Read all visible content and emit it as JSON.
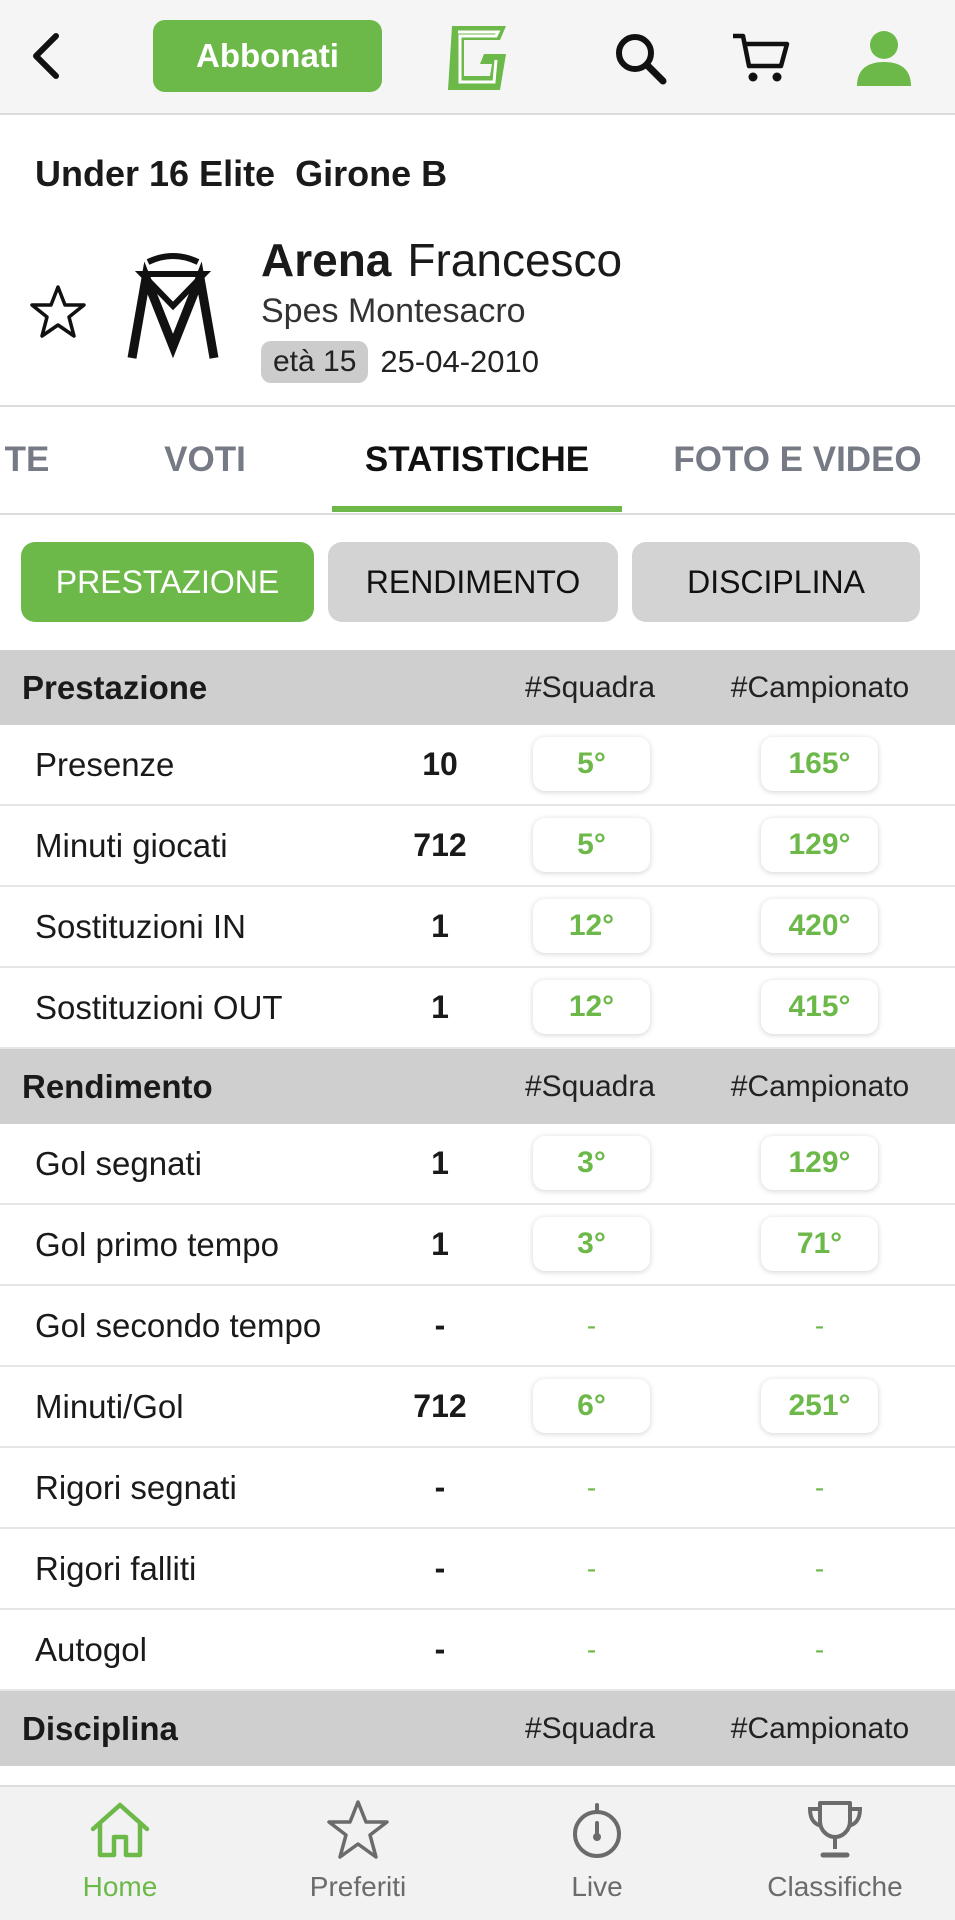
{
  "topbar": {
    "back_icon": "chevron-left-icon",
    "subscribe_label": "Abbonati",
    "logo_letter": "G",
    "search_icon": "search-icon",
    "cart_icon": "cart-icon",
    "user_icon": "user-icon"
  },
  "header": {
    "league": "Under 16 Elite  Girone B",
    "player_last": "Arena",
    "player_first": "Francesco",
    "team": "Spes Montesacro",
    "age_badge": "età 15",
    "dob": "25-04-2010"
  },
  "tabs": [
    {
      "label": "TE",
      "active": false
    },
    {
      "label": "VOTI",
      "active": false
    },
    {
      "label": "STATISTICHE",
      "active": true
    },
    {
      "label": "FOTO E VIDEO",
      "active": false
    }
  ],
  "filters": [
    {
      "label": "PRESTAZIONE",
      "active": true
    },
    {
      "label": "RENDIMENTO",
      "active": false
    },
    {
      "label": "DISCIPLINA",
      "active": false
    }
  ],
  "sections": [
    {
      "title": "Prestazione",
      "col_squadra": "#Squadra",
      "col_campionato": "#Campionato",
      "rows": [
        {
          "label": "Presenze",
          "value": "10",
          "squadra": "5°",
          "campionato": "165°"
        },
        {
          "label": "Minuti giocati",
          "value": "712",
          "squadra": "5°",
          "campionato": "129°"
        },
        {
          "label": "Sostituzioni IN",
          "value": "1",
          "squadra": "12°",
          "campionato": "420°"
        },
        {
          "label": "Sostituzioni OUT",
          "value": "1",
          "squadra": "12°",
          "campionato": "415°"
        }
      ]
    },
    {
      "title": "Rendimento",
      "col_squadra": "#Squadra",
      "col_campionato": "#Campionato",
      "rows": [
        {
          "label": "Gol segnati",
          "value": "1",
          "squadra": "3°",
          "campionato": "129°"
        },
        {
          "label": "Gol primo tempo",
          "value": "1",
          "squadra": "3°",
          "campionato": "71°"
        },
        {
          "label": "Gol secondo tempo",
          "value": "-",
          "squadra": "-",
          "campionato": "-"
        },
        {
          "label": "Minuti/Gol",
          "value": "712",
          "squadra": "6°",
          "campionato": "251°"
        },
        {
          "label": "Rigori segnati",
          "value": "-",
          "squadra": "-",
          "campionato": "-"
        },
        {
          "label": "Rigori falliti",
          "value": "-",
          "squadra": "-",
          "campionato": "-"
        },
        {
          "label": "Autogol",
          "value": "-",
          "squadra": "-",
          "campionato": "-"
        }
      ]
    },
    {
      "title": "Disciplina",
      "col_squadra": "#Squadra",
      "col_campionato": "#Campionato",
      "rows": []
    }
  ],
  "bottom_nav": [
    {
      "label": "Home",
      "icon": "home-icon",
      "active": true
    },
    {
      "label": "Preferiti",
      "icon": "star-icon",
      "active": false
    },
    {
      "label": "Live",
      "icon": "stopwatch-icon",
      "active": false
    },
    {
      "label": "Classifiche",
      "icon": "trophy-icon",
      "active": false
    }
  ],
  "colors": {
    "accent": "#6cb94a",
    "section_bg": "#cfcfcf",
    "tab_inactive": "#757a85"
  }
}
